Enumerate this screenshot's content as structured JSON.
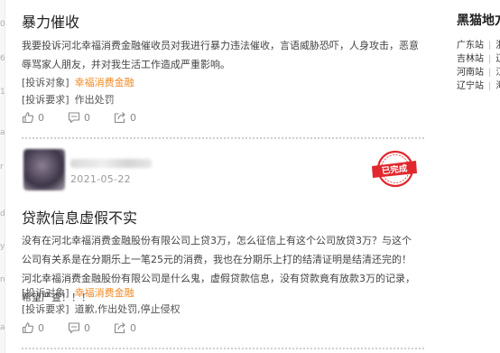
{
  "left_edge_marks": [
    "0",
    "6",
    "1",
    "a",
    "r",
    "d",
    "y",
    "n",
    "a"
  ],
  "posts": [
    {
      "title": "暴力催收",
      "body": "我要投诉河北幸福消费金融催收员对我进行暴力违法催收，言语威胁恐吓，人身攻击，恶意辱骂家人朋友，并对我生活工作造成严重影响。",
      "target_tag": "[投诉对象]",
      "target": "幸福消费金融",
      "request_tag": "[投诉要求]",
      "request": "作出处罚",
      "likes": "0",
      "comments": "0",
      "shares": "0"
    },
    {
      "user_date": "2021-05-22",
      "status_badge": "已完成",
      "title": "贷款信息虚假不实",
      "body": "没有在河北幸福消费金融股份有限公司上贷3万，怎么征信上有这个公司放贷3万？与这个公司有关系是在分期乐上一笔25元的消费，我也在分期乐上打的结清证明是结清还完的！河北幸福消费金融股份有限公司是什么鬼，虚假贷款信息，没有贷款竟有放款3万的记录，希望严查！！！",
      "target_tag": "[投诉对象]",
      "target": "幸福消费金融",
      "request_tag": "[投诉要求]",
      "request": "道歉,作出处罚,停止侵权",
      "likes": "0",
      "comments": "0",
      "shares": "0"
    }
  ],
  "sidebar": {
    "title": "黑猫地方",
    "items": [
      {
        "site": "广东站",
        "next": "浙"
      },
      {
        "site": "吉林站",
        "next": "辽"
      },
      {
        "site": "河南站",
        "next": "江"
      },
      {
        "site": "辽宁站",
        "next": "海"
      }
    ]
  },
  "colors": {
    "accent_orange": "#f08a24",
    "stamp_red": "#e0282e",
    "icon_gray": "#888888"
  },
  "icons": [
    "thumb-up-icon",
    "comment-icon",
    "share-icon",
    "completed-stamp-icon"
  ]
}
